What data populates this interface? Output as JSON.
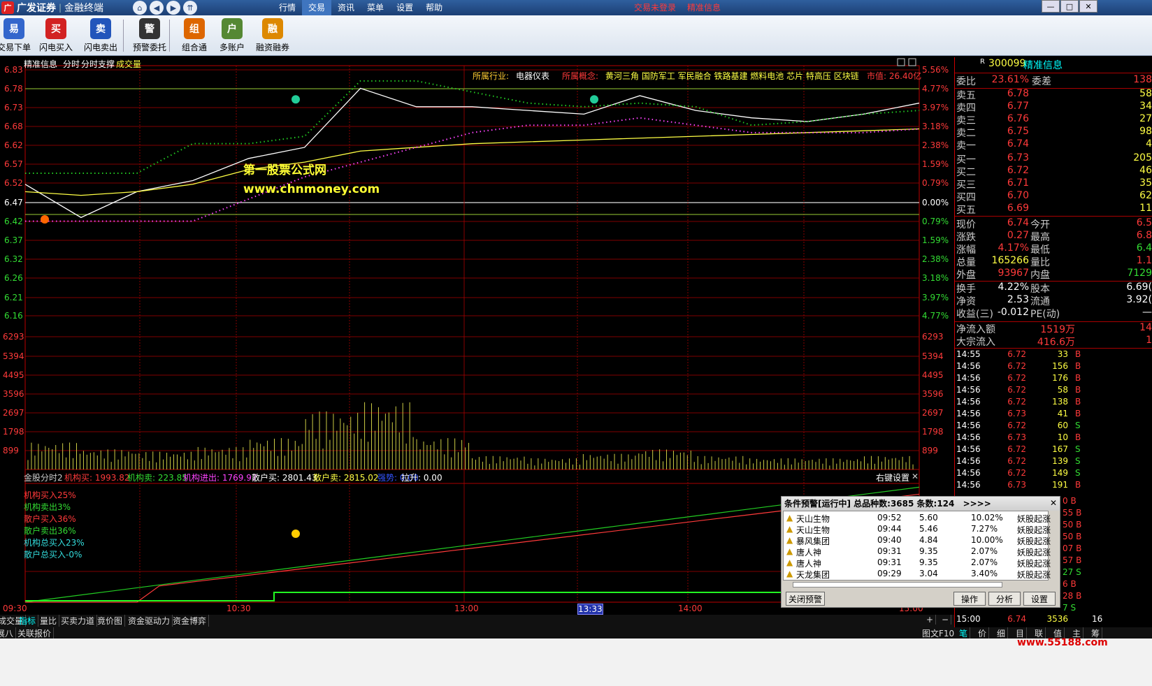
{
  "window": {
    "brand": "广发证券",
    "terminal": "金融终端",
    "menu": [
      "行情",
      "交易",
      "资讯",
      "菜单",
      "设置",
      "帮助"
    ],
    "active_menu": "交易",
    "status_trade": "交易未登录",
    "status_stock": "精准信息",
    "controls": [
      "—",
      "□",
      "✕"
    ]
  },
  "toolbar": {
    "buttons": [
      {
        "label": "交易下单",
        "icon": "trade-order-icon",
        "glyph": "易",
        "color": "#3366cc"
      },
      {
        "label": "闪电买入",
        "icon": "flash-buy-icon",
        "glyph": "买",
        "color": "#d22222"
      },
      {
        "label": "闪电卖出",
        "icon": "flash-sell-icon",
        "glyph": "卖",
        "color": "#2255bb"
      },
      {
        "label": "预警委托",
        "icon": "alert-order-icon",
        "glyph": "警",
        "color": "#333333"
      },
      {
        "label": "组合通",
        "icon": "portfolio-icon",
        "glyph": "组",
        "color": "#dd6600"
      },
      {
        "label": "多账户",
        "icon": "multi-account-icon",
        "glyph": "户",
        "color": "#558833"
      },
      {
        "label": "融资融券",
        "icon": "margin-trading-icon",
        "glyph": "融",
        "color": "#dd8800"
      }
    ]
  },
  "chart": {
    "tabs": [
      "精准信息",
      "分时",
      "分时支撑",
      "成交量"
    ],
    "industry_label": "所属行业:",
    "industry": "电器仪表",
    "concept_label": "所属概念:",
    "concepts": "黄河三角 国防军工 军民融合 铁路基建 燃料电池 芯片 特高压 区块链",
    "market_value": "市值: 26.40亿",
    "watermark_title": "第一股票公式网",
    "watermark_url": "www.chnmoney.com",
    "price_ticks": [
      "6.83",
      "6.78",
      "6.73",
      "6.68",
      "6.62",
      "6.57",
      "6.52",
      "6.47",
      "6.42",
      "6.37",
      "6.32",
      "6.26",
      "6.21",
      "6.16"
    ],
    "pct_ticks": [
      "5.56%",
      "4.77%",
      "3.97%",
      "3.18%",
      "2.38%",
      "1.59%",
      "0.79%",
      "0.00%",
      "0.79%",
      "1.59%",
      "2.38%",
      "3.18%",
      "3.97%",
      "4.77%"
    ],
    "volume_ticks": [
      "6293",
      "5394",
      "4495",
      "3596",
      "2697",
      "1798",
      "899"
    ],
    "time_ticks": [
      "09:30",
      "10:30",
      "13:00",
      "13:33",
      "14:00",
      "15:00"
    ],
    "indicator_header": [
      {
        "text": "金股分时2",
        "color": "#cccccc"
      },
      {
        "text": "机构买: 1993.82",
        "color": "#ff3a3a"
      },
      {
        "text": "机构卖: 223.85",
        "color": "#33dd33"
      },
      {
        "text": "机构进出: 1769.97",
        "color": "#ff44ff"
      },
      {
        "text": "散户买: 2801.43",
        "color": "#ffffff"
      },
      {
        "text": "散户卖: 2815.02",
        "color": "#ffff44"
      },
      {
        "text": "强势: 0.00",
        "color": "#3355ff"
      },
      {
        "text": "拉升: 0.00",
        "color": "#ffffff"
      }
    ],
    "right_click": "右键设置",
    "legend": [
      {
        "text": "机构买入25%",
        "color": "#ff3a3a"
      },
      {
        "text": "机构卖出3%",
        "color": "#33dd33"
      },
      {
        "text": "散户买入36%",
        "color": "#ff3a3a"
      },
      {
        "text": "散户卖出36%",
        "color": "#33dd33"
      },
      {
        "text": "机构总买入23%",
        "color": "#33dddd"
      },
      {
        "text": "散户总买入-0%",
        "color": "#33dddd"
      }
    ]
  },
  "chart_data": {
    "type": "line",
    "title": "精准信息 分时",
    "prev_close": 6.47,
    "ylim": [
      6.16,
      6.83
    ],
    "time_points": [
      "09:30",
      "09:45",
      "10:00",
      "10:15",
      "10:30",
      "10:45",
      "11:00",
      "11:15",
      "11:30/13:00",
      "13:15",
      "13:30",
      "13:45",
      "14:00",
      "14:15",
      "14:30",
      "14:45",
      "15:00"
    ],
    "series": [
      {
        "name": "price",
        "values": [
          6.52,
          6.43,
          6.5,
          6.53,
          6.59,
          6.62,
          6.78,
          6.73,
          6.73,
          6.72,
          6.71,
          6.76,
          6.72,
          6.7,
          6.69,
          6.71,
          6.74
        ]
      },
      {
        "name": "avg",
        "values": [
          6.5,
          6.49,
          6.5,
          6.52,
          6.56,
          6.58,
          6.61,
          6.62,
          6.63,
          6.635,
          6.64,
          6.645,
          6.65,
          6.655,
          6.66,
          6.665,
          6.67
        ]
      },
      {
        "name": "resistance",
        "values": [
          6.55,
          6.55,
          6.55,
          6.63,
          6.63,
          6.65,
          6.8,
          6.8,
          6.77,
          6.74,
          6.73,
          6.74,
          6.73,
          6.68,
          6.69,
          6.71,
          6.72
        ]
      },
      {
        "name": "support",
        "values": [
          6.42,
          6.42,
          6.42,
          6.42,
          6.48,
          6.54,
          6.58,
          6.62,
          6.66,
          6.68,
          6.68,
          6.7,
          6.68,
          6.66,
          6.66,
          6.66,
          6.67
        ]
      }
    ],
    "volume": [
      1200,
      900,
      800,
      1000,
      1400,
      2600,
      3000,
      1400,
      600,
      500,
      700,
      900,
      600,
      500,
      500,
      600,
      1800
    ]
  },
  "quote": {
    "code_tag": "R",
    "code": "300099",
    "name": "精准信息",
    "weibi_label": "委比",
    "weibi": "23.61%",
    "weicha_label": "委差",
    "weicha": "138",
    "asks": [
      {
        "label": "卖五",
        "price": "6.78",
        "vol": "58"
      },
      {
        "label": "卖四",
        "price": "6.77",
        "vol": "34"
      },
      {
        "label": "卖三",
        "price": "6.76",
        "vol": "27"
      },
      {
        "label": "卖二",
        "price": "6.75",
        "vol": "98"
      },
      {
        "label": "卖一",
        "price": "6.74",
        "vol": "4"
      }
    ],
    "bids": [
      {
        "label": "买一",
        "price": "6.73",
        "vol": "205"
      },
      {
        "label": "买二",
        "price": "6.72",
        "vol": "46"
      },
      {
        "label": "买三",
        "price": "6.71",
        "vol": "35"
      },
      {
        "label": "买四",
        "price": "6.70",
        "vol": "62"
      },
      {
        "label": "买五",
        "price": "6.69",
        "vol": "11"
      }
    ],
    "stats": [
      {
        "l1": "现价",
        "v1": "6.74",
        "c1": "#ff3a3a",
        "l2": "今开",
        "v2": "6.5",
        "c2": "#ff3a3a"
      },
      {
        "l1": "涨跌",
        "v1": "0.27",
        "c1": "#ff3a3a",
        "l2": "最高",
        "v2": "6.8",
        "c2": "#ff3a3a"
      },
      {
        "l1": "涨幅",
        "v1": "4.17%",
        "c1": "#ff3a3a",
        "l2": "最低",
        "v2": "6.4",
        "c2": "#33dd33"
      },
      {
        "l1": "总量",
        "v1": "165266",
        "c1": "#ffff44",
        "l2": "量比",
        "v2": "1.1",
        "c2": "#ff3a3a"
      },
      {
        "l1": "外盘",
        "v1": "93967",
        "c1": "#ff3a3a",
        "l2": "内盘",
        "v2": "7129",
        "c2": "#33dd33"
      }
    ],
    "stats2": [
      {
        "l1": "换手",
        "v1": "4.22%",
        "l2": "股本",
        "v2": "6.69("
      },
      {
        "l1": "净资",
        "v1": "2.53",
        "l2": "流通",
        "v2": "3.92("
      },
      {
        "l1": "收益(三)",
        "v1": "-0.012",
        "l2": "PE(动)",
        "v2": "—"
      }
    ],
    "flows": [
      {
        "label": "净流入额",
        "value": "1519万",
        "extra": "14"
      },
      {
        "label": "大宗流入",
        "value": "416.6万",
        "extra": "1"
      }
    ],
    "ticks": [
      {
        "t": "14:55",
        "p": "6.72",
        "v": "33",
        "s": "B"
      },
      {
        "t": "14:56",
        "p": "6.72",
        "v": "156",
        "s": "B"
      },
      {
        "t": "14:56",
        "p": "6.72",
        "v": "176",
        "s": "B"
      },
      {
        "t": "14:56",
        "p": "6.72",
        "v": "58",
        "s": "B"
      },
      {
        "t": "14:56",
        "p": "6.72",
        "v": "138",
        "s": "B"
      },
      {
        "t": "14:56",
        "p": "6.73",
        "v": "41",
        "s": "B"
      },
      {
        "t": "14:56",
        "p": "6.72",
        "v": "60",
        "s": "S"
      },
      {
        "t": "14:56",
        "p": "6.73",
        "v": "10",
        "s": "B"
      },
      {
        "t": "14:56",
        "p": "6.72",
        "v": "167",
        "s": "S"
      },
      {
        "t": "14:56",
        "p": "6.72",
        "v": "139",
        "s": "S"
      },
      {
        "t": "14:56",
        "p": "6.72",
        "v": "149",
        "s": "S"
      },
      {
        "t": "14:56",
        "p": "6.73",
        "v": "191",
        "s": "B"
      }
    ],
    "partial_ticks": [
      "0 B",
      "55 B",
      "50 B",
      "50 B",
      "07 B",
      "57 B",
      "27 S",
      "6 B",
      "28 B",
      "7 S"
    ],
    "last_tick": {
      "t": "15:00",
      "p": "6.74",
      "v": "3536",
      "x": "16"
    }
  },
  "alert": {
    "title": "条件预警[运行中] 总品种数:3685 条数:124",
    "arrows": ">>>>",
    "rows": [
      {
        "name": "天山生物",
        "time": "09:52",
        "price": "5.60",
        "pct": "10.02%",
        "tag": "妖股起涨"
      },
      {
        "name": "天山生物",
        "time": "09:44",
        "price": "5.46",
        "pct": "7.27%",
        "tag": "妖股起涨"
      },
      {
        "name": "暴风集团",
        "time": "09:40",
        "price": "4.84",
        "pct": "10.00%",
        "tag": "妖股起涨"
      },
      {
        "name": "唐人神",
        "time": "09:31",
        "price": "9.35",
        "pct": "2.07%",
        "tag": "妖股起涨"
      },
      {
        "name": "唐人神",
        "time": "09:31",
        "price": "9.35",
        "pct": "2.07%",
        "tag": "妖股起涨"
      },
      {
        "name": "天龙集团",
        "time": "09:29",
        "price": "3.04",
        "pct": "3.40%",
        "tag": "妖股起涨"
      }
    ],
    "close_btn": "关闭预警",
    "op_btn": "操作",
    "analyze_btn": "分析",
    "settings_btn": "设置"
  },
  "bottom_tabs": [
    "成交量",
    "指标",
    "量比",
    "买卖力道",
    "竟价图",
    "资金驱动力",
    "资金博弈"
  ],
  "bottom_tabs2": [
    "展八",
    "关联报价"
  ],
  "bottom_right": [
    "图文F10"
  ],
  "rp_bottom_tabs": [
    "笔",
    "价",
    "细",
    "目",
    "联",
    "值",
    "主",
    "筹"
  ],
  "zoom": [
    "+",
    "−"
  ],
  "site_watermark": "www.55188.com"
}
